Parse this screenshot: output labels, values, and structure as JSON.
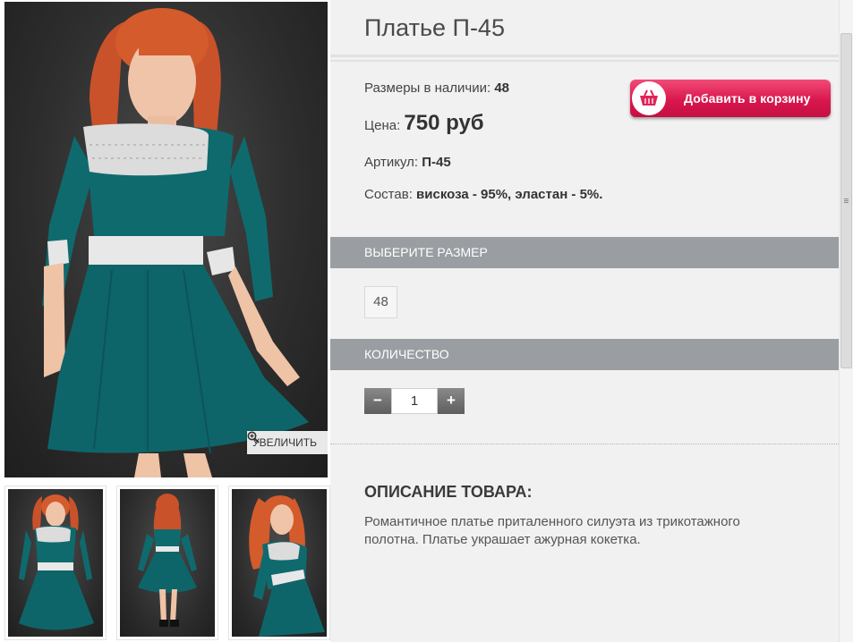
{
  "product": {
    "title": "Платье П-45",
    "sizes_label": "Размеры в наличии:",
    "sizes_value": "48",
    "price_label": "Цена:",
    "price_value": "750 руб",
    "sku_label": "Артикул:",
    "sku_value": "П-45",
    "composition_label": "Состав:",
    "composition_value": "вискоза - 95%, эластан - 5%."
  },
  "cart_button": {
    "label": "Добавить в корзину",
    "icon": "basket-icon"
  },
  "gallery": {
    "zoom_label": "УВЕЛИЧИТЬ",
    "zoom_icon": "magnifier-plus-icon",
    "thumbnail_count": 3
  },
  "size_section": {
    "title": "ВЫБЕРИТЕ РАЗМЕР",
    "options": [
      "48"
    ]
  },
  "quantity_section": {
    "title": "КОЛИЧЕСТВО",
    "minus": "−",
    "plus": "+",
    "value": "1"
  },
  "description": {
    "title": "ОПИСАНИЕ ТОВАРА:",
    "text": "Романтичное платье приталенного силуэта из трикотажного полотна. Платье украшает ажурная кокетка."
  },
  "colors": {
    "cart_button": "#d9174e",
    "section_bar": "#9a9ea2",
    "panel_bg": "#f1f1f1",
    "dress": "#0f6a6e"
  }
}
